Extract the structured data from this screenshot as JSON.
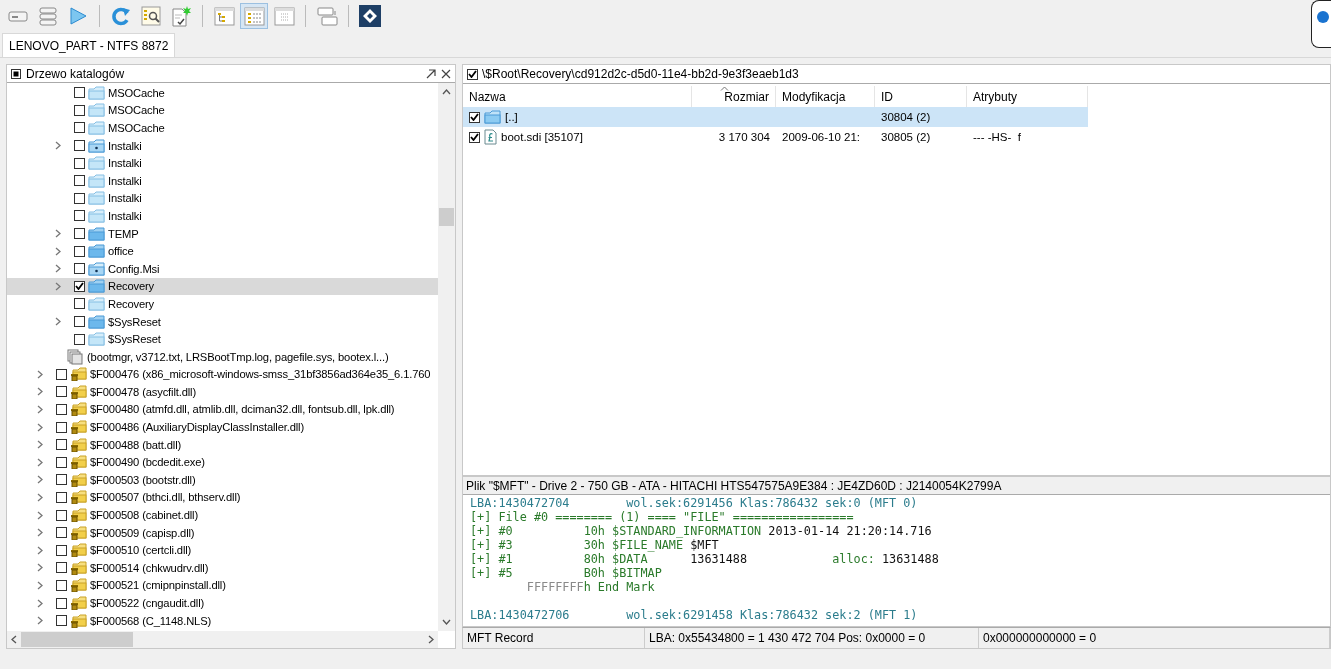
{
  "toolbar": [
    {
      "kind": "drive"
    },
    {
      "kind": "list"
    },
    {
      "kind": "play"
    },
    {
      "kind": "separator"
    },
    {
      "kind": "refresh"
    },
    {
      "kind": "search"
    },
    {
      "kind": "check-new"
    },
    {
      "kind": "separator"
    },
    {
      "kind": "tree-view",
      "selected": false
    },
    {
      "kind": "list-view",
      "selected": true
    },
    {
      "kind": "grid-view",
      "selected": false
    },
    {
      "kind": "separator"
    },
    {
      "kind": "panes"
    },
    {
      "kind": "separator"
    },
    {
      "kind": "logo"
    }
  ],
  "tabs": [
    {
      "label": "LENOVO_PART - NTFS 8872",
      "selected": true
    }
  ],
  "tree_panel": {
    "title": "Drzewo katalogów",
    "items": [
      {
        "children": [
          {
            "label": "MSOCache",
            "kind": "folder-empty",
            "expandable": false,
            "checked": false,
            "selected": false
          },
          {
            "label": "MSOCache",
            "kind": "folder-empty",
            "expandable": false,
            "checked": false,
            "selected": false
          },
          {
            "label": "MSOCache",
            "kind": "folder-empty",
            "expandable": false,
            "checked": false,
            "selected": false
          },
          {
            "label": "Instalki",
            "kind": "folder-special",
            "expandable": true,
            "checked": false,
            "selected": false
          },
          {
            "label": "Instalki",
            "kind": "folder-empty",
            "expandable": false,
            "checked": false,
            "selected": false
          },
          {
            "label": "Instalki",
            "kind": "folder-empty",
            "expandable": false,
            "checked": false,
            "selected": false
          },
          {
            "label": "Instalki",
            "kind": "folder-empty",
            "expandable": false,
            "checked": false,
            "selected": false
          },
          {
            "label": "Instalki",
            "kind": "folder-empty",
            "expandable": false,
            "checked": false,
            "selected": false
          },
          {
            "label": "TEMP",
            "kind": "folder",
            "expandable": true,
            "checked": false,
            "selected": false
          },
          {
            "label": "office",
            "kind": "folder",
            "expandable": true,
            "checked": false,
            "selected": false
          },
          {
            "label": "Config.Msi",
            "kind": "folder-special",
            "expandable": true,
            "checked": false,
            "selected": false
          },
          {
            "label": "Recovery",
            "kind": "folder",
            "expandable": true,
            "checked": true,
            "selected": true
          },
          {
            "label": "Recovery",
            "kind": "folder-empty",
            "expandable": false,
            "checked": false,
            "selected": false
          },
          {
            "label": "$SysReset",
            "kind": "folder",
            "expandable": true,
            "checked": false,
            "selected": false
          },
          {
            "label": "$SysReset",
            "kind": "folder-empty",
            "expandable": false,
            "checked": false,
            "selected": false
          },
          {
            "label": "(bootmgr, v3712.txt, LRSBootTmp.log, pagefile.sys, bootex.l...)",
            "kind": "files",
            "expandable": false,
            "selected": false
          }
        ]
      },
      {
        "label": "$F000476 (x86_microsoft-windows-smss_31bf3856ad364e35_6.1.760",
        "kind": "deleted-folder",
        "expandable": true,
        "checked": false,
        "selected": false
      },
      {
        "label": "$F000478 (asycfilt.dll)",
        "kind": "deleted-folder",
        "expandable": true,
        "checked": false,
        "selected": false
      },
      {
        "label": "$F000480 (atmfd.dll, atmlib.dll, dciman32.dll, fontsub.dll, lpk.dll)",
        "kind": "deleted-folder",
        "expandable": true,
        "checked": false,
        "selected": false
      },
      {
        "label": "$F000486 (AuxiliaryDisplayClassInstaller.dll)",
        "kind": "deleted-folder",
        "expandable": true,
        "checked": false,
        "selected": false
      },
      {
        "label": "$F000488 (batt.dll)",
        "kind": "deleted-folder",
        "expandable": true,
        "checked": false,
        "selected": false
      },
      {
        "label": "$F000490 (bcdedit.exe)",
        "kind": "deleted-folder",
        "expandable": true,
        "checked": false,
        "selected": false
      },
      {
        "label": "$F000503 (bootstr.dll)",
        "kind": "deleted-folder",
        "expandable": true,
        "checked": false,
        "selected": false
      },
      {
        "label": "$F000507 (bthci.dll, bthserv.dll)",
        "kind": "deleted-folder",
        "expandable": true,
        "checked": false,
        "selected": false
      },
      {
        "label": "$F000508 (cabinet.dll)",
        "kind": "deleted-folder",
        "expandable": true,
        "checked": false,
        "selected": false
      },
      {
        "label": "$F000509 (capisp.dll)",
        "kind": "deleted-folder",
        "expandable": true,
        "checked": false,
        "selected": false
      },
      {
        "label": "$F000510 (certcli.dll)",
        "kind": "deleted-folder",
        "expandable": true,
        "checked": false,
        "selected": false
      },
      {
        "label": "$F000514 (chkwudrv.dll)",
        "kind": "deleted-folder",
        "expandable": true,
        "checked": false,
        "selected": false
      },
      {
        "label": "$F000521 (cmipnpinstall.dll)",
        "kind": "deleted-folder",
        "expandable": true,
        "checked": false,
        "selected": false
      },
      {
        "label": "$F000522 (cngaudit.dll)",
        "kind": "deleted-folder",
        "expandable": true,
        "checked": false,
        "selected": false
      },
      {
        "label": "$F000568 (C_1148.NLS)",
        "kind": "deleted-folder",
        "expandable": true,
        "checked": false,
        "selected": false
      }
    ]
  },
  "file_list": {
    "path": "\\$Root\\Recovery\\cd912d2c-d5d0-11e4-bb2d-9e3f3eaeb1d3",
    "path_checked": true,
    "columns": [
      {
        "label": "Nazwa",
        "sorted": false
      },
      {
        "label": "Rozmiar",
        "sorted": true
      },
      {
        "label": "Modyfikacja",
        "sorted": false
      },
      {
        "label": "ID",
        "sorted": false
      },
      {
        "label": "Atrybuty",
        "sorted": false
      }
    ],
    "rows": [
      {
        "kind": "folder",
        "checked": true,
        "selected": true,
        "name": "[..]",
        "size": "",
        "modified": "",
        "id": "30804 (2)",
        "attributes": ""
      },
      {
        "kind": "file",
        "checked": true,
        "selected": false,
        "name": "boot.sdi [35107]",
        "size": "3 170 304",
        "modified": "2009-06-10 21:",
        "id": "30805 (2)",
        "attributes": "--- -HS-  f"
      }
    ]
  },
  "record_panel": {
    "title": "Plik \"$MFT\" - Drive 2 - 750 GB - ATA - HITACHI HTS547575A9E384 : JE4ZD60D : J2140054K2799A",
    "records": [
      {
        "lines": [
          [
            {
              "kind": "address",
              "text": "LBA:1430472704        wol.sek:6291456 Klas:786432 sek:0 (MFT 0)"
            }
          ],
          [
            {
              "kind": "header",
              "text": "[+] File #0 ======== (1) ==== \"FILE\" ================="
            }
          ],
          [
            {
              "kind": "header",
              "text": "[+] #0          10h $STANDARD_INFORMATION "
            },
            {
              "kind": "value",
              "text": "2013-01-14 21:20:14.716"
            }
          ],
          [
            {
              "kind": "header",
              "text": "[+] #3          30h $FILE_NAME "
            },
            {
              "kind": "value",
              "text": "$MFT"
            }
          ],
          [
            {
              "kind": "header",
              "text": "[+] #1          80h $DATA      "
            },
            {
              "kind": "value",
              "text": "13631488            "
            },
            {
              "kind": "header",
              "text": "alloc: "
            },
            {
              "kind": "value",
              "text": "13631488"
            }
          ],
          [
            {
              "kind": "header",
              "text": "[+] #5          B0h $BITMAP"
            }
          ],
          [
            {
              "kind": "muted",
              "text": "        FFFFFFFF"
            },
            {
              "kind": "header",
              "text": "h End Mark"
            }
          ]
        ]
      },
      {
        "lines": [
          [
            {
              "kind": "address",
              "text": "LBA:1430472706        wol.sek:6291458 Klas:786432 sek:2 (MFT 1)"
            }
          ]
        ]
      }
    ]
  },
  "status_bar": [
    "MFT Record",
    "LBA: 0x55434800 = 1 430 472 704  Pos: 0x0000 = 0",
    "0x000000000000 = 0"
  ]
}
